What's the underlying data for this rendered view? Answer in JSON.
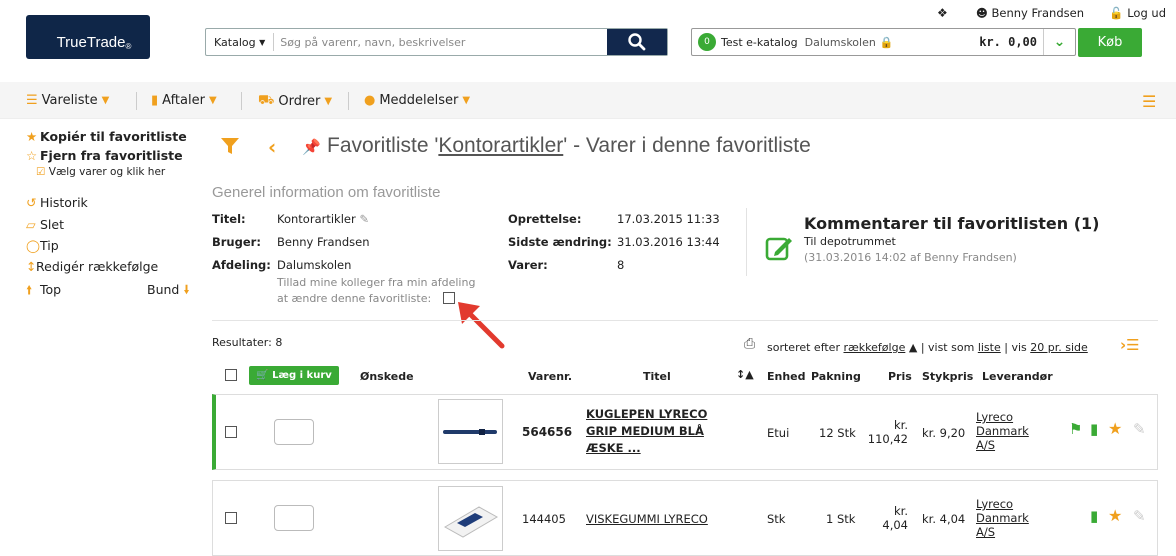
{
  "header": {
    "logo_text": "TrueTrade",
    "logo_mark": "®",
    "user_name": "Benny Frandsen",
    "logout": "Log ud",
    "search_scope": "Katalog",
    "search_placeholder": "Søg på varenr, navn, beskrivelser",
    "cart_count": "0",
    "cart_catalog": "Test e-katalog",
    "cart_org": "Dalumskolen",
    "cart_amount": "kr. 0,00",
    "buy_label": "Køb"
  },
  "nav": {
    "items": [
      {
        "label": "Vareliste",
        "icon": "list-icon"
      },
      {
        "label": "Aftaler",
        "icon": "document-icon"
      },
      {
        "label": "Ordrer",
        "icon": "truck-icon"
      },
      {
        "label": "Meddelelser",
        "icon": "chat-icon"
      }
    ]
  },
  "sidebar": {
    "copy_fav": "Kopiér til favoritliste",
    "remove_fav": "Fjern fra favoritliste",
    "hint": "Vælg varer og klik her",
    "history": "Historik",
    "delete": "Slet",
    "tip": "Tip",
    "edit_order": "Redigér rækkefølge",
    "top": "Top",
    "bottom": "Bund"
  },
  "page": {
    "title_prefix": "Favoritliste '",
    "title_link": "Kontorartikler",
    "title_suffix": "' - Varer i denne favoritliste",
    "general_info": "Generel information om favoritliste"
  },
  "info": {
    "titel_label": "Titel:",
    "titel_value": "Kontorartikler",
    "bruger_label": "Bruger:",
    "bruger_value": "Benny Frandsen",
    "afdeling_label": "Afdeling:",
    "afdeling_value": "Dalumskolen",
    "allow_line1": "Tillad mine kolleger fra min afdeling",
    "allow_line2": "at ændre denne favoritliste:",
    "oprettelse_label": "Oprettelse:",
    "oprettelse_value": "17.03.2015 11:33",
    "sidste_label": "Sidste ændring:",
    "sidste_value": "31.03.2016 13:44",
    "varer_label": "Varer:",
    "varer_value": "8"
  },
  "comments": {
    "title": "Kommentarer til favoritlisten (1)",
    "text": "Til depotrummet",
    "meta": "(31.03.2016 14:02 af Benny Frandsen)"
  },
  "results": {
    "label": "Resultater: 8",
    "sorted_by": "sorteret efter",
    "sort_field": "rækkefølge",
    "view_as": "| vist som",
    "view_mode": "liste",
    "show": "| vis",
    "per_page": "20 pr. side"
  },
  "table": {
    "add_to_cart": "Læg i kurv",
    "columns": {
      "wanted": "Ønskede",
      "itemno": "Varenr.",
      "title": "Titel",
      "unit": "Enhed",
      "pack": "Pakning",
      "price": "Pris",
      "unit_price": "Stykpris",
      "supplier": "Leverandør"
    },
    "rows": [
      {
        "itemno": "564656",
        "title_l1": "KUGLEPEN LYRECO",
        "title_l2": "GRIP MEDIUM BLÅ",
        "title_l3": "ÆSKE ...",
        "unit": "Etui",
        "pack": "12 Stk",
        "price_l1": "kr.",
        "price_l2": "110,42",
        "unit_price": "kr. 9,20",
        "supplier_l1": "Lyreco",
        "supplier_l2": "Danmark",
        "supplier_l3": "A/S"
      },
      {
        "itemno": "144405",
        "title_l1": "VISKEGUMMI LYRECO",
        "unit": "Stk",
        "pack": "1 Stk",
        "price_l1": "kr.",
        "price_l2": "4,04",
        "unit_price": "kr. 4,04",
        "supplier_l1": "Lyreco",
        "supplier_l2": "Danmark",
        "supplier_l3": "A/S"
      }
    ]
  },
  "colors": {
    "accent": "#f0a01e",
    "green": "#3aaa35",
    "navy": "#12284d"
  }
}
